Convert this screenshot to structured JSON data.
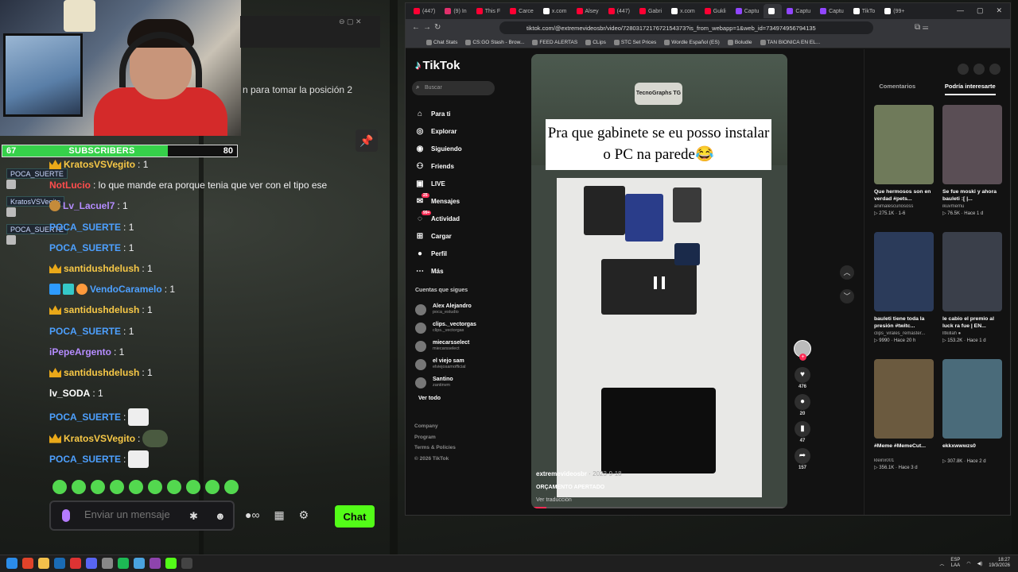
{
  "stream": {
    "subscribers": {
      "label": "SUBSCRIBERS",
      "current": "67",
      "goal": "80",
      "progress": 0.84
    },
    "overlay_badges": [
      "POCA_SUERTE",
      "KratosVSVegito",
      "POCA_SUERTE"
    ],
    "chat_cut_text": "n para tomar la posición 2",
    "messages": [
      {
        "user": "KratosVSVegito",
        "text": ": 1",
        "color": "gold",
        "badge": "crown"
      },
      {
        "user": "NotLucio",
        "text": ": lo que mande era porque tenia que ver con el tipo ese",
        "color": "red",
        "badge": ""
      },
      {
        "user": "Lv_Lacuel7",
        "text": ": 1",
        "color": "purple",
        "badge": "emote"
      },
      {
        "user": "POCA_SUERTE",
        "text": ": 1",
        "color": "blue",
        "badge": ""
      },
      {
        "user": "POCA_SUERTE",
        "text": ": 1",
        "color": "blue",
        "badge": ""
      },
      {
        "user": "santidushdelush",
        "text": ": 1",
        "color": "gold",
        "badge": "crown"
      },
      {
        "user": "VendoCaramelo",
        "text": ": 1",
        "color": "blue",
        "badge": "multi"
      },
      {
        "user": "santidushdelush",
        "text": ": 1",
        "color": "gold",
        "badge": "crown"
      },
      {
        "user": "POCA_SUERTE",
        "text": ": 1",
        "color": "blue",
        "badge": ""
      },
      {
        "user": "iPepeArgento",
        "text": ": 1",
        "color": "purple",
        "badge": ""
      },
      {
        "user": "santidushdelush",
        "text": ": 1",
        "color": "gold",
        "badge": "crown"
      },
      {
        "user": "lv_SODA",
        "text": ": 1",
        "color": "white",
        "badge": ""
      },
      {
        "user": "POCA_SUERTE",
        "text": ":",
        "color": "blue",
        "badge": "",
        "emote": "light"
      },
      {
        "user": "KratosVSVegito",
        "text": ":",
        "color": "gold",
        "badge": "crown",
        "emote": "dark"
      },
      {
        "user": "POCA_SUERTE",
        "text": ":",
        "color": "blue",
        "badge": "",
        "emote": "light"
      }
    ],
    "input_placeholder": "Enviar un mensaje",
    "send_label": "Chat"
  },
  "browser": {
    "tabs": [
      {
        "label": "(447)",
        "color": "#ff0033"
      },
      {
        "label": "(9) In",
        "color": "#e1306c"
      },
      {
        "label": "This F",
        "color": "#ff0033"
      },
      {
        "label": "Carce",
        "color": "#ff0033"
      },
      {
        "label": "x.com",
        "color": "#ffffff"
      },
      {
        "label": "Alsey",
        "color": "#ff0033"
      },
      {
        "label": "(447)",
        "color": "#ff0033"
      },
      {
        "label": "Gabri",
        "color": "#ff0033"
      },
      {
        "label": "x.com",
        "color": "#ffffff"
      },
      {
        "label": "Gukli",
        "color": "#ff0033"
      },
      {
        "label": "Captu",
        "color": "#9146ff"
      },
      {
        "label": "",
        "color": "#ffffff",
        "active": true
      },
      {
        "label": "Captu",
        "color": "#9146ff"
      },
      {
        "label": "Captu",
        "color": "#9146ff"
      },
      {
        "label": "TikTo",
        "color": "#ffffff"
      },
      {
        "label": "(99+",
        "color": "#ffffff"
      }
    ],
    "url": "tiktok.com/@extremevideosbr/video/7280317217672154373?is_from_webapp=1&web_id=734974956794135",
    "bookmarks": [
      "Chat Stats",
      "CS:GO Stash - Brow...",
      "FEED ALERTAS",
      "CLips",
      "STC Set Prices",
      "Wordle Español (ES)",
      "Boludle",
      "TAN BIONICA EN EL..."
    ]
  },
  "tiktok": {
    "logo": "TikTok",
    "search_placeholder": "Buscar",
    "nav": [
      {
        "label": "Para ti",
        "icon": "home-icon"
      },
      {
        "label": "Explorar",
        "icon": "compass-icon"
      },
      {
        "label": "Siguiendo",
        "icon": "following-icon"
      },
      {
        "label": "Friends",
        "icon": "friends-icon"
      },
      {
        "label": "LIVE",
        "icon": "live-icon"
      },
      {
        "label": "Mensajes",
        "icon": "messages-icon",
        "badge": "25"
      },
      {
        "label": "Actividad",
        "icon": "activity-icon",
        "badge": "99+"
      },
      {
        "label": "Cargar",
        "icon": "upload-icon"
      },
      {
        "label": "Perfil",
        "icon": "profile-icon"
      },
      {
        "label": "Más",
        "icon": "more-icon"
      }
    ],
    "following_heading": "Cuentas que sigues",
    "following": [
      {
        "name": "Alex Alejandro",
        "handle": "poca_estudio"
      },
      {
        "name": "clips._vectorgas",
        "handle": "clips._vectorgas"
      },
      {
        "name": "miecarsselect",
        "handle": "miecarsselect"
      },
      {
        "name": "el viejo sam",
        "handle": "elviejosamofficial"
      },
      {
        "name": "Santino",
        "handle": "zantinvm"
      }
    ],
    "see_all": "Ver todo",
    "footer": [
      "Company",
      "Program",
      "Terms & Policies",
      "© 2026 TikTok"
    ],
    "video": {
      "caption": "Pra que gabinete se eu posso instalar o PC na parede😂",
      "logo_text": "TecnoGraphs TG",
      "author": "extremevideosbr",
      "date": "· 2023-9-18",
      "description": "ORÇAMENTO APERTADO",
      "translate": "Ver traducción",
      "progress": 0.06
    },
    "actions": [
      {
        "icon": "heart-icon",
        "glyph": "♥",
        "count": "476"
      },
      {
        "icon": "comment-icon",
        "glyph": "●",
        "count": "20"
      },
      {
        "icon": "bookmark-icon",
        "glyph": "▮",
        "count": "47"
      },
      {
        "icon": "share-icon",
        "glyph": "➦",
        "count": "157"
      }
    ],
    "right_tabs": [
      "Comentarios",
      "Podría interesarte"
    ],
    "cards": [
      {
        "title": "Que hermosos son en verdad #pets...",
        "author": "animalescuriososs",
        "stats": "▷ 275.1K · 1-6",
        "color": "#6f7a5a"
      },
      {
        "title": "Se fue moski y ahora bauleti :[ |...",
        "author": "ikuvmemu",
        "stats": "▷ 76.5K · Hace 1 d",
        "color": "#5a4e55"
      },
      {
        "title": "bauleti tiene toda la presión #twitc...",
        "author": "clips_virales_remaster...",
        "stats": "▷ 9990 · Hace 20 h",
        "color": "#2b3b5a"
      },
      {
        "title": "le cabio el premio al luck ra fue | EN...",
        "author": "lltkillah ●",
        "stats": "▷ 153.2K · Hace 1 d",
        "color": "#3a3f4a"
      },
      {
        "title": "#Meme #MemeCut...",
        "author": "kleinx001",
        "stats": "▷ 356.1K · Hace 3 d",
        "color": "#6b5a3f"
      },
      {
        "title": "ekkxwwwzs0",
        "author": "",
        "stats": "▷ 307.8K · Hace 2 d",
        "color": "#4a6b7a"
      }
    ]
  },
  "taskbar": {
    "lang": "ESP",
    "region": "LAA",
    "time": "18:27",
    "date": "19/3/2026"
  }
}
